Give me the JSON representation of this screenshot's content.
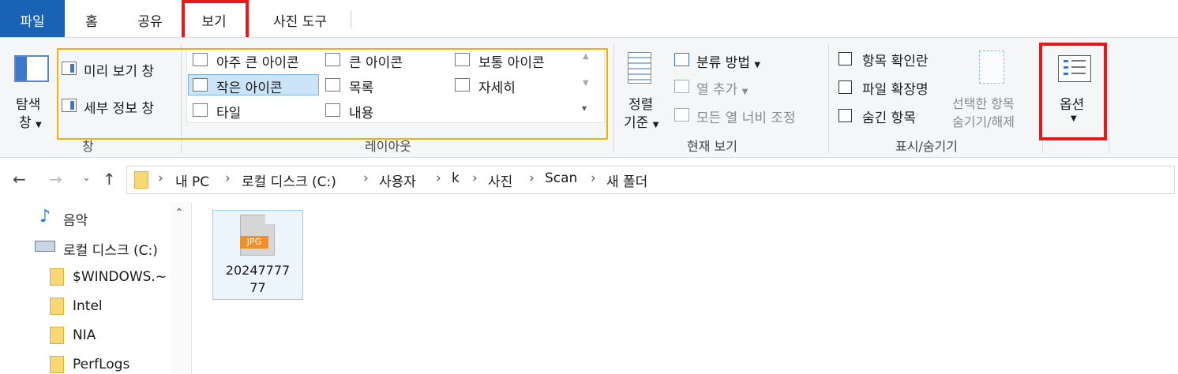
{
  "tabs": {
    "file": "파일",
    "home": "홈",
    "share": "공유",
    "view": "보기",
    "picture_tools": "사진 도구"
  },
  "ribbon": {
    "panes": {
      "nav_pane": "탐색",
      "nav_pane2": "창",
      "preview_pane": "미리 보기 창",
      "details_pane": "세부 정보 창",
      "group_label": "창"
    },
    "layout": {
      "extra_large_icons": "아주 큰 아이콘",
      "large_icons": "큰 아이콘",
      "medium_icons": "보통 아이콘",
      "small_icons": "작은 아이콘",
      "list": "목록",
      "details": "자세히",
      "tiles": "타일",
      "content": "내용",
      "group_label": "레이아웃"
    },
    "current_view": {
      "sort_by": "정렬",
      "sort_by2": "기준",
      "group_by": "분류 방법",
      "add_columns": "열 추가",
      "size_all_columns": "모든 열 너비 조정",
      "group_label": "현재 보기"
    },
    "show_hide": {
      "item_checkboxes": "항목 확인란",
      "file_name_extensions": "파일 확장명",
      "hidden_items": "숨긴 항목",
      "hide_selected": "선택한 항목",
      "hide_selected2": "숨기기/해제",
      "group_label": "표시/숨기기"
    },
    "options": {
      "label": "옵션"
    }
  },
  "address": {
    "crumbs": [
      "내 PC",
      "로컬 디스크 (C:)",
      "사용자",
      "k",
      "사진",
      "Scan",
      "새 폴더"
    ]
  },
  "nav": {
    "music": "음악",
    "local_disk": "로컬 디스크 (C:)",
    "folders": [
      "$WINDOWS.~",
      "Intel",
      "NIA",
      "PerfLogs"
    ]
  },
  "file": {
    "badge": "JPG",
    "name_line1": "20247777",
    "name_line2": "77"
  }
}
